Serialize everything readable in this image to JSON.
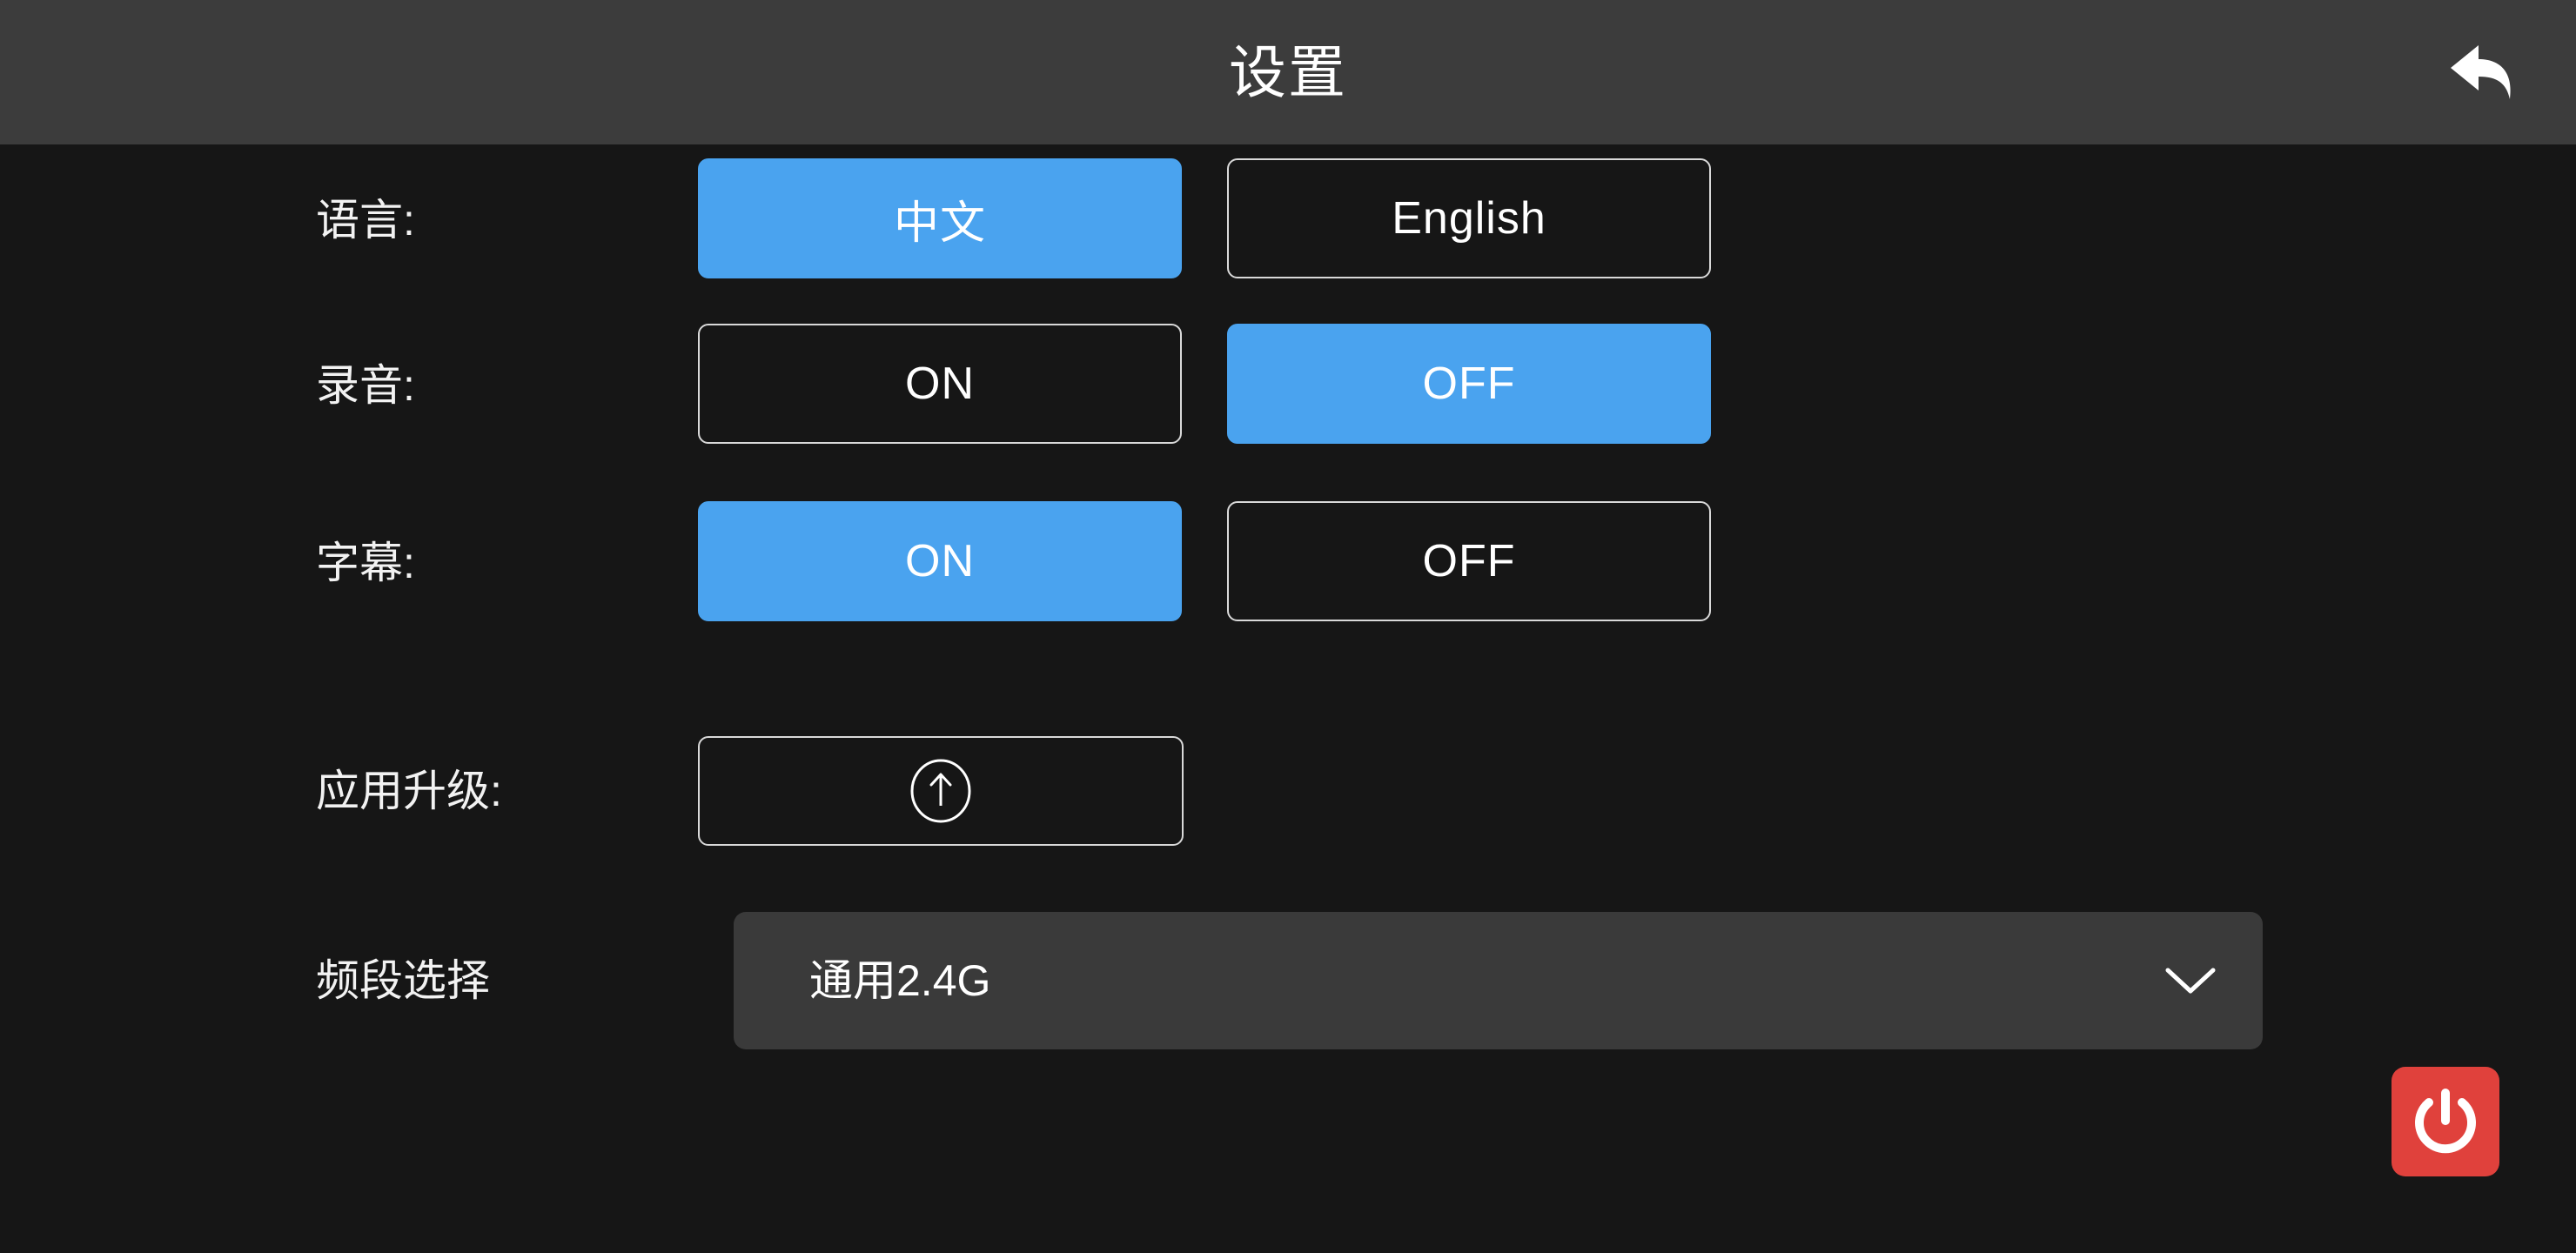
{
  "header": {
    "title": "设置",
    "back_icon": "back-arrow-icon"
  },
  "colors": {
    "accent_blue": "#4aa3ef",
    "header_bg": "#3c3c3c",
    "page_bg": "#161616",
    "dropdown_bg": "#3a3a3a",
    "power_red": "#e0413c",
    "outline": "#d9d9d9",
    "text": "#ffffff"
  },
  "settings": {
    "language": {
      "label": "语言:",
      "options": [
        {
          "value": "中文",
          "selected": true
        },
        {
          "value": "English",
          "selected": false
        }
      ]
    },
    "recording": {
      "label": "录音:",
      "options": [
        {
          "value": "ON",
          "selected": false
        },
        {
          "value": "OFF",
          "selected": true
        }
      ]
    },
    "subtitle": {
      "label": "字幕:",
      "options": [
        {
          "value": "ON",
          "selected": true
        },
        {
          "value": "OFF",
          "selected": false
        }
      ]
    },
    "app_upgrade": {
      "label": "应用升级:",
      "icon": "circle-arrow-up-icon"
    },
    "band_selection": {
      "label": "频段选择",
      "selected_value": "通用2.4G",
      "chevron_icon": "chevron-down-icon"
    }
  },
  "power": {
    "icon": "power-icon"
  }
}
